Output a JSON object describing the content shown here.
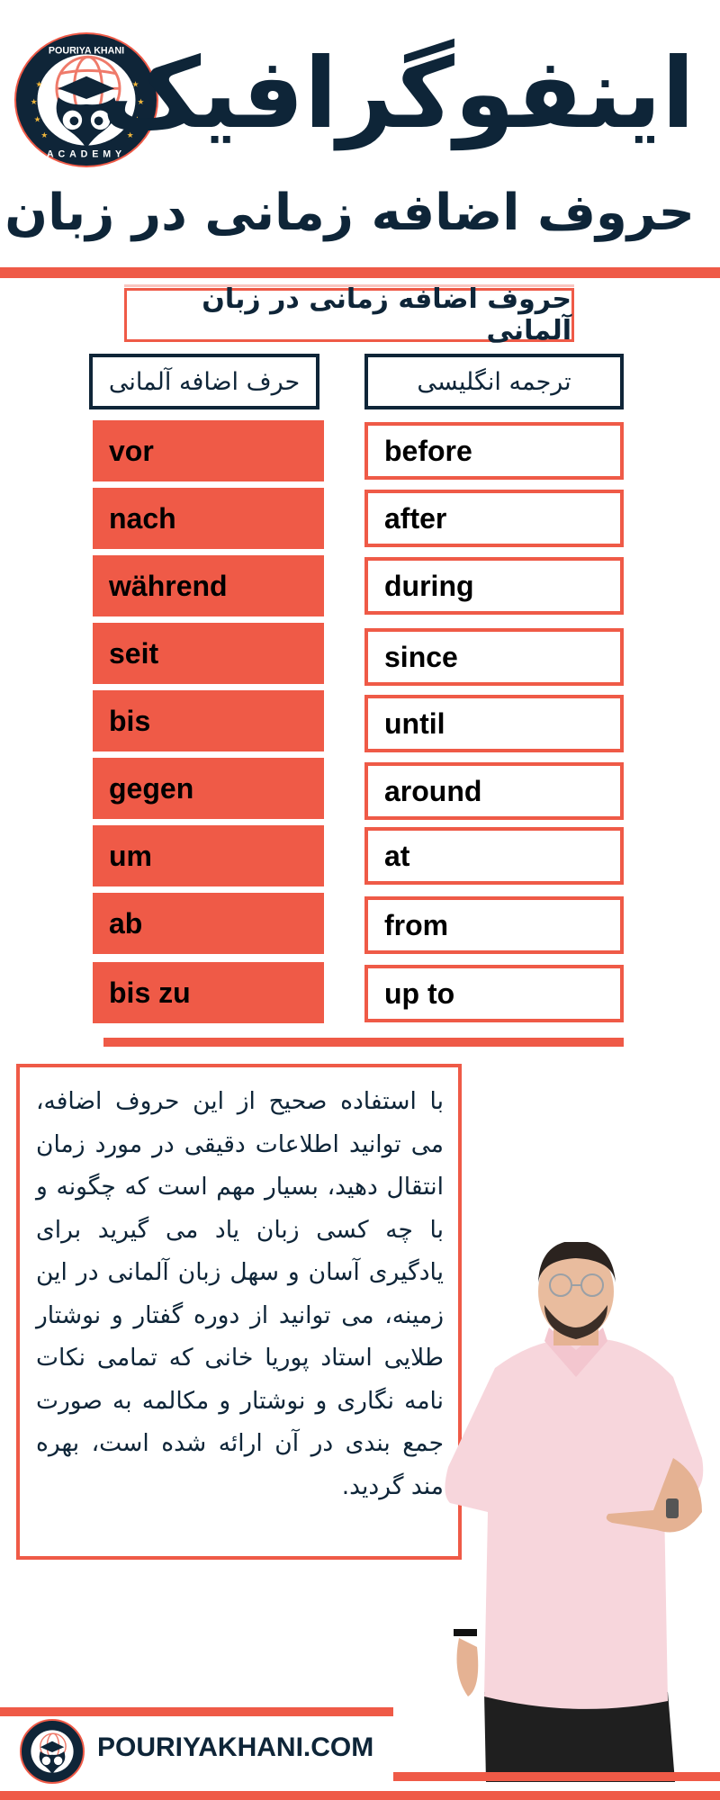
{
  "brand": {
    "logo_top_text": "POURIYA KHANI",
    "logo_bottom_text": "ACADEMY",
    "website": "POURIYAKHANI.COM",
    "colors": {
      "accent": "#ef5a47",
      "navy": "#0f2538",
      "shirt": "#f7d6dc"
    }
  },
  "header": {
    "title": "اینفوگرافیک",
    "subtitle": "حروف اضافه زمانی در زبان آلمانی"
  },
  "table": {
    "heading": "حروف اضافه زمانی در زبان آلمانی",
    "columns": {
      "german": "حرف اضافه آلمانی",
      "english": "ترجمه انگلیسی"
    },
    "rows": [
      {
        "german": "vor",
        "english": "before"
      },
      {
        "german": "nach",
        "english": "after"
      },
      {
        "german": "während",
        "english": "during"
      },
      {
        "german": "seit",
        "english": "since"
      },
      {
        "german": "bis",
        "english": "until"
      },
      {
        "german": "gegen",
        "english": "around"
      },
      {
        "german": "um",
        "english": "at"
      },
      {
        "german": "ab",
        "english": "from"
      },
      {
        "german": "bis zu",
        "english": "up to"
      }
    ]
  },
  "paragraph": "با استفاده صحیح از این حروف اضافه، می توانید اطلاعات دقیقی در مورد زمان انتقال دهید، بسیار مهم است که چگونه و با چه کسی زبان یاد می گیرید برای یادگیری آسان و سهل زبان آلمانی در این زمینه، می توانید از دوره گفتار و نوشتار طلایی استاد پوریا خانی که تمامی نکات نامه نگاری و نوشتار و مکالمه به صورت جمع بندی در آن ارائه شده است، بهره مند گردید."
}
